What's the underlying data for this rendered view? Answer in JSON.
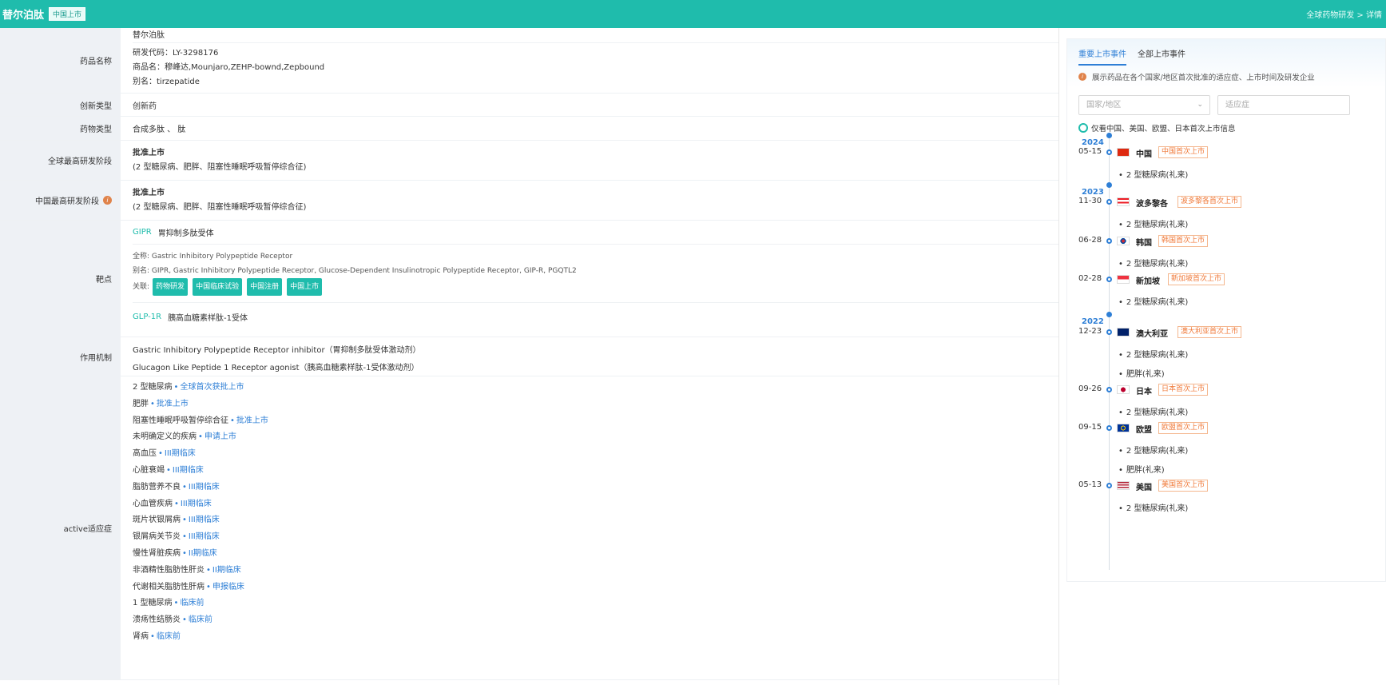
{
  "header": {
    "title": "替尔泊肽",
    "badge": "中国上市",
    "breadcrumb": "全球药物研发 > 详情"
  },
  "drug": {
    "name_label": "药品名称",
    "name": "替尔泊肽",
    "code": "研发代码：LY-3298176",
    "trade_names": "商品名：穆峰达,Mounjaro,ZEHP-bownd,Zepbound",
    "alias": "别名：tirzepatide",
    "innovation_label": "创新类型",
    "innovation": "创新药",
    "type_label": "药物类型",
    "type": "合成多肽 、 肽",
    "global_stage_label": "全球最高研发阶段",
    "global_stage": "批准上市",
    "global_stage_ind": "(2 型糖尿病、肥胖、阻塞性睡眠呼吸暂停综合征)",
    "china_stage_label": "中国最高研发阶段",
    "china_stage": "批准上市",
    "china_stage_ind": "(2 型糖尿病、肥胖、阻塞性睡眠呼吸暂停综合征)",
    "target_label": "靶点",
    "target1_code": "GIPR",
    "target1_name": "胃抑制多肽受体",
    "target1_full": "全称:  Gastric Inhibitory Polypeptide Receptor",
    "target1_alias": "别名:  GIPR, Gastric Inhibitory Polypeptide Receptor, Glucose-Dependent Insulinotropic Polypeptide Receptor, GIP-R, PGQTL2",
    "target1_rel_label": "关联:",
    "target1_chips": [
      "药物研发",
      "中国临床试验",
      "中国注册",
      "中国上市"
    ],
    "target2_code": "GLP-1R",
    "target2_name": "胰高血糖素样肽-1受体",
    "moa_label": "作用机制",
    "moa1": "Gastric Inhibitory Polypeptide Receptor inhibitor（胃抑制多肽受体激动剂）",
    "moa2": "Glucagon Like Peptide 1 Receptor agonist（胰高血糖素样肽-1受体激动剂）",
    "ind_label": "active适应症",
    "indications": [
      {
        "name": "2 型糖尿病",
        "stage": "全球首次获批上市"
      },
      {
        "name": "肥胖",
        "stage": "批准上市"
      },
      {
        "name": "阻塞性睡眠呼吸暂停综合征",
        "stage": "批准上市"
      },
      {
        "name": "未明确定义的疾病",
        "stage": "申请上市"
      },
      {
        "name": "高血压",
        "stage": "III期临床"
      },
      {
        "name": "心脏衰竭",
        "stage": "III期临床"
      },
      {
        "name": "脂肪营养不良",
        "stage": "III期临床"
      },
      {
        "name": "心血管疾病",
        "stage": "III期临床"
      },
      {
        "name": "斑片状银屑病",
        "stage": "III期临床"
      },
      {
        "name": "银屑病关节炎",
        "stage": "III期临床"
      },
      {
        "name": "慢性肾脏疾病",
        "stage": "II期临床"
      },
      {
        "name": "非酒精性脂肪性肝炎",
        "stage": "II期临床"
      },
      {
        "name": "代谢相关脂肪性肝病",
        "stage": "申报临床"
      },
      {
        "name": "1 型糖尿病",
        "stage": "临床前"
      },
      {
        "name": "溃疡性结肠炎",
        "stage": "临床前"
      },
      {
        "name": "肾病",
        "stage": "临床前"
      }
    ]
  },
  "side": {
    "tab_active": "重要上市事件",
    "tab_other": "全部上市事件",
    "hint": "展示药品在各个国家/地区首次批准的适应症、上市时间及研发企业",
    "country_placeholder": "国家/地区",
    "indication_placeholder": "适应症",
    "checkbox_label": "仅看中国、美国、欧盟、日本首次上市信息",
    "years": [
      "2024",
      "2023",
      "2022"
    ],
    "events": [
      {
        "date": "05-15",
        "country": "中国",
        "tag": "中国首次上市",
        "flag": "cn",
        "inds": [
          "2 型糖尿病(礼来)"
        ]
      },
      {
        "date": "11-30",
        "country": "波多黎各",
        "tag": "波多黎各首次上市",
        "flag": "pr",
        "inds": [
          "2 型糖尿病(礼来)"
        ]
      },
      {
        "date": "06-28",
        "country": "韩国",
        "tag": "韩国首次上市",
        "flag": "kr",
        "inds": [
          "2 型糖尿病(礼来)"
        ]
      },
      {
        "date": "02-28",
        "country": "新加坡",
        "tag": "新加坡首次上市",
        "flag": "sg",
        "inds": [
          "2 型糖尿病(礼来)"
        ]
      },
      {
        "date": "12-23",
        "country": "澳大利亚",
        "tag": "澳大利亚首次上市",
        "flag": "au",
        "inds": [
          "2 型糖尿病(礼来)",
          "肥胖(礼来)"
        ]
      },
      {
        "date": "09-26",
        "country": "日本",
        "tag": "日本首次上市",
        "flag": "jp",
        "inds": [
          "2 型糖尿病(礼来)"
        ]
      },
      {
        "date": "09-15",
        "country": "欧盟",
        "tag": "欧盟首次上市",
        "flag": "eu",
        "inds": [
          "2 型糖尿病(礼来)",
          "肥胖(礼来)"
        ]
      },
      {
        "date": "05-13",
        "country": "美国",
        "tag": "美国首次上市",
        "flag": "us",
        "inds": [
          "2 型糖尿病(礼来)"
        ]
      }
    ]
  },
  "colors": {
    "header": "#1fbcac",
    "link": "#2e7fd6",
    "tag": "#f07a3a"
  }
}
